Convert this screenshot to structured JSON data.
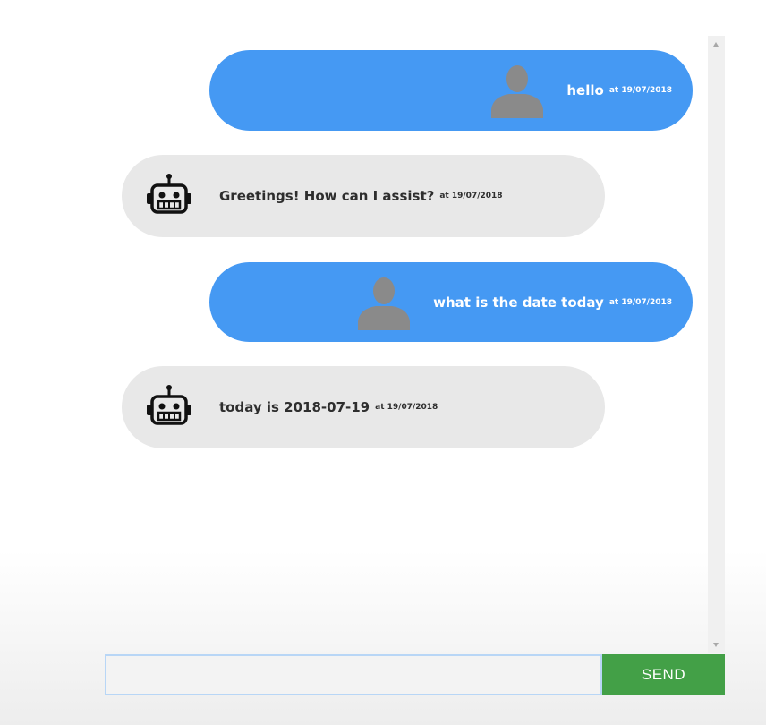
{
  "messages": [
    {
      "sender": "user",
      "text": "hello",
      "time": "at 19/07/2018",
      "avatar_icon": "user-silhouette-icon"
    },
    {
      "sender": "bot",
      "text": "Greetings! How can I assist?",
      "time": "at 19/07/2018",
      "avatar_icon": "robot-icon"
    },
    {
      "sender": "user",
      "text": "what is the date today",
      "time": "at 19/07/2018",
      "avatar_icon": "user-silhouette-icon"
    },
    {
      "sender": "bot",
      "text": "today is 2018-07-19",
      "time": "at 19/07/2018",
      "avatar_icon": "robot-icon"
    }
  ],
  "composer": {
    "input_value": "",
    "send_label": "SEND"
  },
  "colors": {
    "user_bubble": "#4599f3",
    "bot_bubble": "#e8e8e8",
    "send_button": "#43a047"
  }
}
